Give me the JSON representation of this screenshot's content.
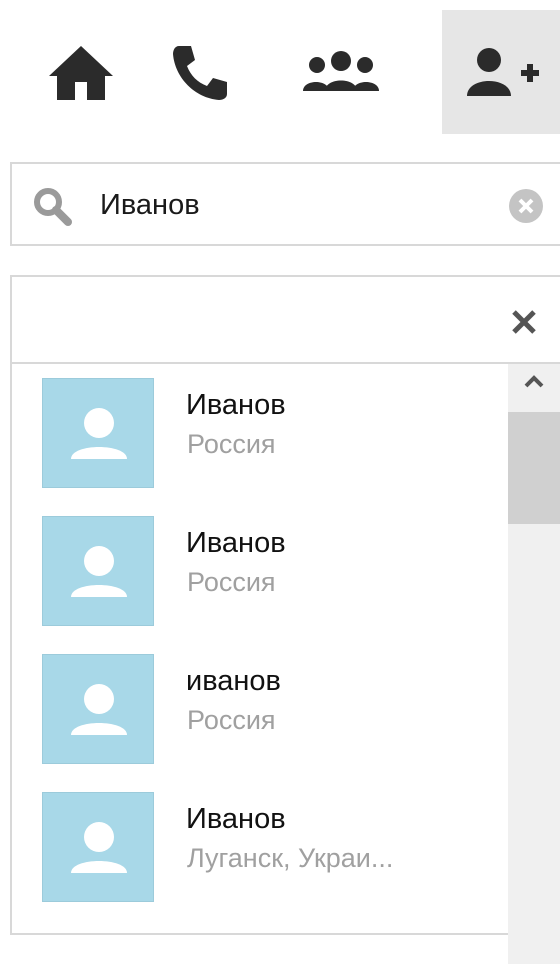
{
  "toolbar": {
    "buttons": [
      {
        "icon": "home-icon",
        "active": false
      },
      {
        "icon": "phone-icon",
        "active": false
      },
      {
        "icon": "group-icon",
        "active": false
      },
      {
        "icon": "add-contact-icon",
        "active": true
      }
    ]
  },
  "search": {
    "icon": "search-icon",
    "value": "Иванов",
    "clear_icon": "clear-icon"
  },
  "results": {
    "close_icon": "close-icon",
    "items": [
      {
        "name": "Иванов",
        "location": "Россия"
      },
      {
        "name": "Иванов",
        "location": "Россия"
      },
      {
        "name": "иванов",
        "location": "Россия"
      },
      {
        "name": "Иванов",
        "location": "Луганск, Украи..."
      }
    ],
    "scrollbar": {
      "up_icon": "chevron-up-icon"
    }
  },
  "colors": {
    "avatar_bg": "#a8d8e8",
    "active_tab_bg": "#e6e6e6",
    "icon_dark": "#2b2b2b",
    "secondary_text": "#a0a0a0"
  }
}
